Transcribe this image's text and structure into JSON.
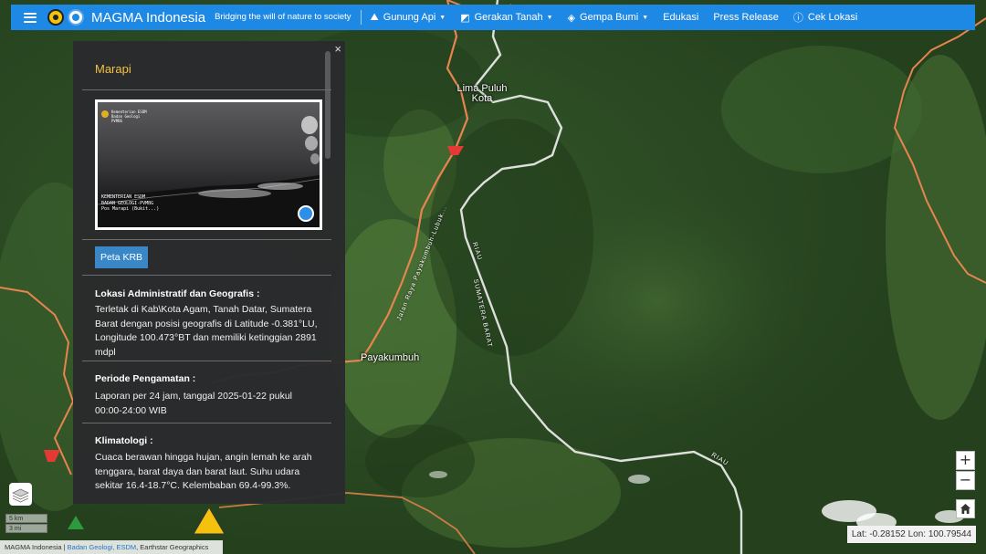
{
  "navbar": {
    "brand": "MAGMA Indonesia",
    "tagline": "Bridging the will of nature to society",
    "items": [
      {
        "label": "Gunung Api",
        "icon": "mountain-icon",
        "dropdown": true
      },
      {
        "label": "Gerakan Tanah",
        "icon": "landslide-icon",
        "dropdown": true
      },
      {
        "label": "Gempa Bumi",
        "icon": "earthquake-icon",
        "dropdown": true
      },
      {
        "label": "Edukasi",
        "dropdown": false
      },
      {
        "label": "Press Release",
        "dropdown": false
      },
      {
        "label": "Cek Lokasi",
        "icon": "info-icon",
        "dropdown": false
      }
    ],
    "accent_color": "#1e88e5"
  },
  "panel": {
    "title": "Marapi",
    "close_glyph": "×",
    "camera": {
      "org_line1": "Kementerian ESDM",
      "org_line2": "Badan Geologi",
      "org_line3": "PVMBG",
      "overlay_line1": "KEMENTERIAN ESDM",
      "overlay_line2": "BADAN GEOLOGI-PVMBG",
      "overlay_line3": "Pos Marapi (Bukit...)"
    },
    "button_krb": "Peta KRB",
    "sections": [
      {
        "heading": "Lokasi Administratif dan Geografis :",
        "body": "Terletak di Kab\\Kota Agam, Tanah Datar, Sumatera Barat dengan posisi geografis di Latitude -0.381°LU, Longitude 100.473°BT dan memiliki ketinggian 2891 mdpl"
      },
      {
        "heading": "Periode Pengamatan :",
        "body": "Laporan per 24 jam, tanggal 2025-01-22 pukul 00:00-24:00 WIB"
      },
      {
        "heading": "Klimatologi :",
        "body": "Cuaca berawan hingga hujan, angin lemah ke arah tenggara, barat daya dan barat laut. Suhu udara sekitar 16.4-18.7°C. Kelembaban 69.4-99.3%."
      }
    ],
    "title_color": "#f5c242"
  },
  "map": {
    "places": [
      {
        "name": "Lima Puluh Kota"
      },
      {
        "name": "Payakumbuh"
      }
    ],
    "road_labels": [
      "Jalan Raya Payakumbuh-Lubuk...",
      "RIAU",
      "SUMATERA BARAT",
      "RIAU"
    ],
    "scale_km": "5 km",
    "scale_mi": "3 mi",
    "zoom_in": "+",
    "zoom_out": "−",
    "latlon": "Lat: -0.28152 Lon: 100.79544",
    "attribution_prefix": "MAGMA Indonesia | ",
    "attribution_link": "Badan Geologi, ESDM",
    "attribution_suffix": ", Earthstar Geographics"
  }
}
